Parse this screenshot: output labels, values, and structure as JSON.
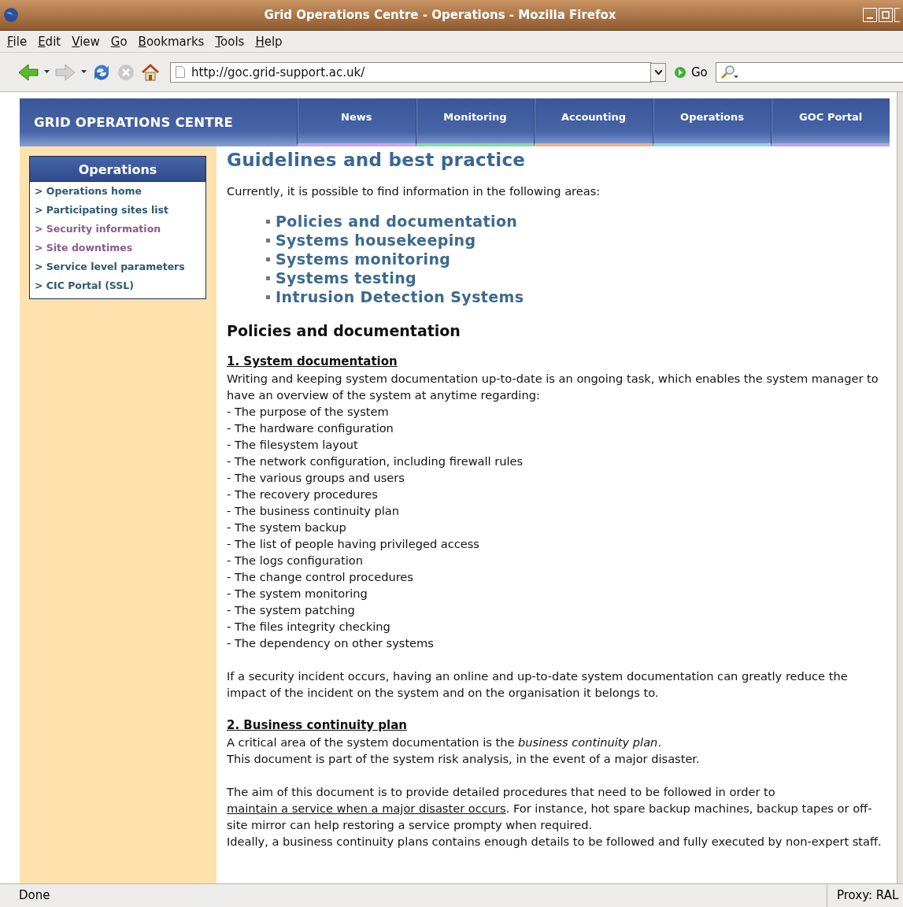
{
  "window": {
    "title": "Grid Operations Centre - Operations - Mozilla Firefox"
  },
  "menu": [
    "File",
    "Edit",
    "View",
    "Go",
    "Bookmarks",
    "Tools",
    "Help"
  ],
  "toolbar": {
    "url": "http://goc.grid-support.ac.uk/",
    "go_label": "Go"
  },
  "banner": {
    "title": "GRID OPERATIONS CENTRE",
    "nav": [
      {
        "label": "News",
        "color": "#c9a6e8"
      },
      {
        "label": "Monitoring",
        "color": "#86dba6"
      },
      {
        "label": "Accounting",
        "color": "#e9b48e"
      },
      {
        "label": "Operations",
        "color": "#90d8ea"
      },
      {
        "label": "GOC Portal",
        "color": "#b9a4ea"
      }
    ]
  },
  "sidebar": {
    "title": "Operations",
    "items": [
      {
        "label": "> Operations home",
        "visited": false
      },
      {
        "label": "> Participating sites list",
        "visited": false
      },
      {
        "label": "> Security information",
        "visited": true
      },
      {
        "label": "> Site downtimes",
        "visited": true
      },
      {
        "label": "> Service level parameters",
        "visited": false
      },
      {
        "label": "> CIC Portal (SSL)",
        "visited": false
      }
    ]
  },
  "content": {
    "heading": "Guidelines and best practice",
    "intro": "Currently, it is possible to find information in the following areas:",
    "areas": [
      "Policies and documentation",
      "Systems housekeeping",
      "Systems monitoring",
      "Systems testing",
      "Intrusion Detection Systems"
    ],
    "section_title": "Policies and documentation",
    "sections": [
      {
        "title": "1. System documentation",
        "paragraphs": [
          {
            "lines": [
              "Writing and keeping system documentation up-to-date is an ongoing task, which enables the system manager to have an overview of the system at anytime regarding:",
              "- The purpose of the system",
              "- The hardware configuration",
              "- The filesystem layout",
              "- The network configuration, including firewall rules",
              "- The various groups and users",
              "- The recovery procedures",
              "- The business continuity plan",
              "- The system backup",
              "- The list of people having privileged access",
              "- The logs configuration",
              "- The change control procedures",
              "- The system monitoring",
              "- The system patching",
              "- The files integrity checking",
              "- The dependency on other systems"
            ]
          },
          {
            "lines": [
              "If a security incident occurs, having an online and up-to-date system documentation can greatly reduce the impact of the incident on the system and on the organisation it belongs to."
            ]
          }
        ]
      },
      {
        "title": "2. Business continuity plan",
        "paragraphs": [
          {
            "lines": [
              "A critical area of the system documentation is the *business continuity plan*.",
              "This document is part of the system risk analysis, in the event of a major disaster."
            ]
          },
          {
            "lines": [
              {
                "parts": [
                  {
                    "text": "The aim of this document is to provide detailed procedures that need to be followed in order to ",
                    "kind": "text"
                  },
                  {
                    "text": "maintain a service when a major disaster occurs",
                    "kind": "link"
                  },
                  {
                    "text": ". For instance, hot spare backup machines, backup tapes or off-site mirror can help restoring a service prompty when required.",
                    "kind": "text"
                  }
                ]
              },
              "Ideally, a business continuity plans contains enough details to be followed and fully executed by non-expert staff."
            ]
          }
        ]
      }
    ]
  },
  "status_bar": {
    "text": "Done",
    "proxy": "Proxy: RAL"
  }
}
